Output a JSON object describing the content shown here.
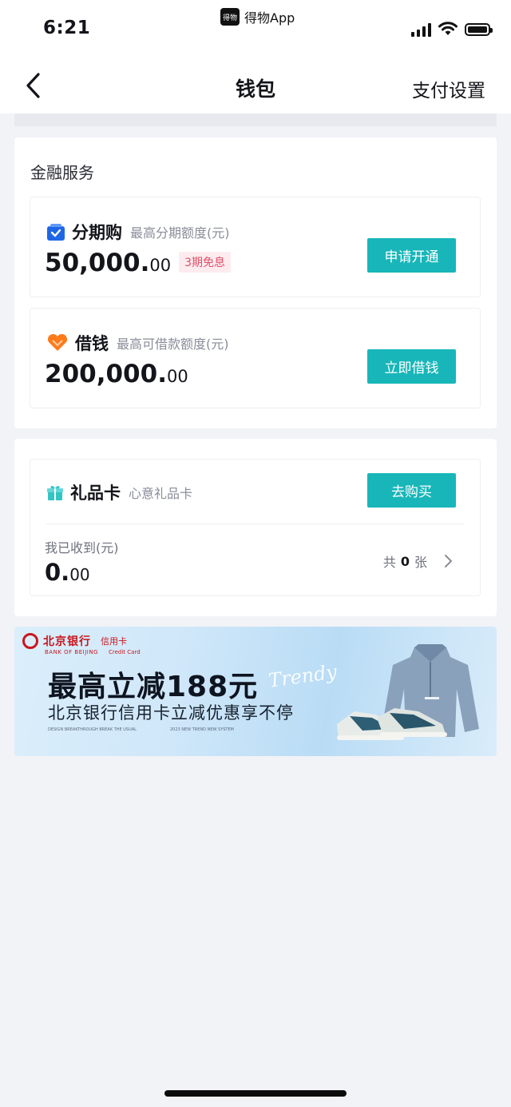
{
  "status_bar": {
    "time": "6:21",
    "app_name": "得物App",
    "app_logo_text": "得物"
  },
  "nav": {
    "title": "钱包",
    "right": "支付设置"
  },
  "finance": {
    "title": "金融服务",
    "installment": {
      "label": "分期购",
      "sub": "最高分期额度(元)",
      "amount_int": "50,000.",
      "amount_dec": "00",
      "tag": "3期免息",
      "button": "申请开通"
    },
    "loan": {
      "label": "借钱",
      "sub": "最高可借款额度(元)",
      "amount_int": "200,000.",
      "amount_dec": "00",
      "button": "立即借钱"
    }
  },
  "gift": {
    "label": "礼品卡",
    "sub": "心意礼品卡",
    "button": "去购买",
    "received_label": "我已收到(元)",
    "amount_int": "0.",
    "amount_dec": "00",
    "count_prefix": "共",
    "count": "0",
    "count_suffix": "张"
  },
  "banner": {
    "bank_cn": "北京银行",
    "bank_en": "BANK OF BEIJING",
    "card_cn": "信用卡",
    "card_en": "Credit Card",
    "headline": "最高立减188元",
    "subline": "北京银行信用卡立减优惠享不停",
    "trendy": "Trendy",
    "tiny_1": "DESIGN BREAKTHROUGH BREAK THE USUAL",
    "tiny_2": "2023 NEW TREND NEW SYSTEM"
  },
  "colors": {
    "accent": "#18b6b9",
    "tag_red": "#e0506a",
    "bank_red": "#c8161d",
    "background": "#f2f3f7"
  }
}
